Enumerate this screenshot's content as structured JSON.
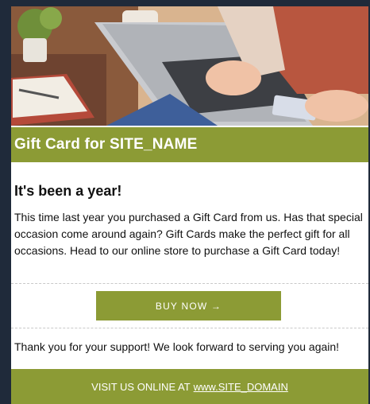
{
  "hero": {
    "image": "woman-typing-on-laptop-holding-card-photo"
  },
  "header": {
    "title": "Gift Card for SITE_NAME"
  },
  "main": {
    "heading": "It's been a year!",
    "body": "This time last year you purchased a Gift Card from us.  Has that special occasion come around again?   Gift Cards make the perfect gift for all occasions. Head to our online store to purchase a Gift Card today!",
    "button_label": "BUY NOW →",
    "thanks": "Thank you for your support! We look forward to serving you again!"
  },
  "footer": {
    "prefix": "VISIT US ONLINE AT",
    "link_text": "www.SITE_DOMAIN"
  },
  "colors": {
    "accent": "#8c9b35",
    "page_bg": "#1f2a3a",
    "text": "#111111"
  }
}
